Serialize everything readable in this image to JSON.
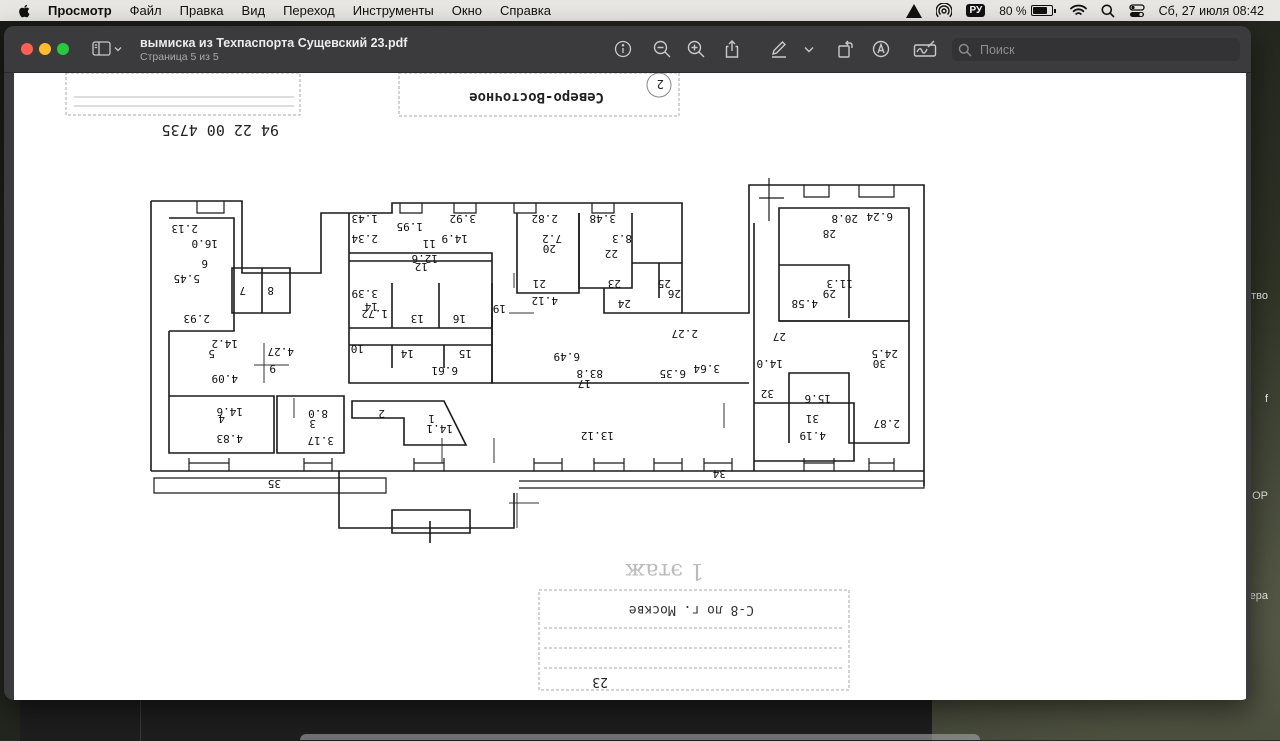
{
  "menubar": {
    "app_name": "Просмотр",
    "items": [
      "Файл",
      "Правка",
      "Вид",
      "Переход",
      "Инструменты",
      "Окно",
      "Справка"
    ],
    "input_source": "РУ",
    "battery_text": "80 %",
    "battery_level": 0.8,
    "datetime": "Сб, 27 июля  08:42"
  },
  "window": {
    "title": "вымиска из Техпаспорта Сущевский 23.pdf",
    "subtitle": "Страница 5 из 5",
    "search_placeholder": "Поиск"
  },
  "background_fragments": [
    "тво",
    "f",
    "ОР",
    "ера"
  ],
  "plan": {
    "stamps": {
      "top_number": "94 22 00 4735",
      "north_east": "Северо-Восточное",
      "circle_num": "2"
    },
    "floor_label": "1 этаж",
    "bottom_page_num": "23",
    "bottom_stamp": "С-8 ло г. Москве",
    "room_labels": [
      "2.13",
      "6",
      "16.0",
      "5.45",
      "7",
      "8",
      "2.93",
      "5",
      "14.2",
      "4.09",
      "9",
      "4.27",
      "4",
      "14.6",
      "4.83",
      "3",
      "8.0",
      "3.17",
      "2",
      "1",
      "14.1",
      "1.43",
      "2.34",
      "1.95",
      "11",
      "14.9",
      "3.92",
      "2.82",
      "20",
      "7.2",
      "3.48",
      "22",
      "8.3",
      "12",
      "12.6",
      "3.39",
      "1.72",
      "14",
      "13",
      "16",
      "10",
      "14",
      "15",
      "6.61",
      "21",
      "4.12",
      "19",
      "23",
      "25",
      "24",
      "26",
      "6.49",
      "17",
      "83.8",
      "13.12",
      "6.35",
      "3.64",
      "2.27",
      "34",
      "35",
      "28",
      "20.8",
      "6.24",
      "29",
      "11.3",
      "4.58",
      "30",
      "24.5",
      "2.87",
      "31",
      "15.6",
      "4.19",
      "32",
      "14.0",
      "27"
    ]
  },
  "colors": {
    "menubar_bg": "#e9e7e3",
    "window_bg": "#3b3b3d",
    "close": "#fe5f57",
    "minimize": "#febc2e",
    "zoom": "#28c840"
  },
  "icons": [
    "apple-icon",
    "warning-icon",
    "airdrop-icon",
    "battery-icon",
    "wifi-icon",
    "search-icon",
    "control-center-icon",
    "sidebar-toggle-icon",
    "chevron-down-icon",
    "info-icon",
    "zoom-out-icon",
    "zoom-in-icon",
    "share-icon",
    "markup-pen-icon",
    "rotate-icon",
    "annotate-icon",
    "signature-icon"
  ]
}
